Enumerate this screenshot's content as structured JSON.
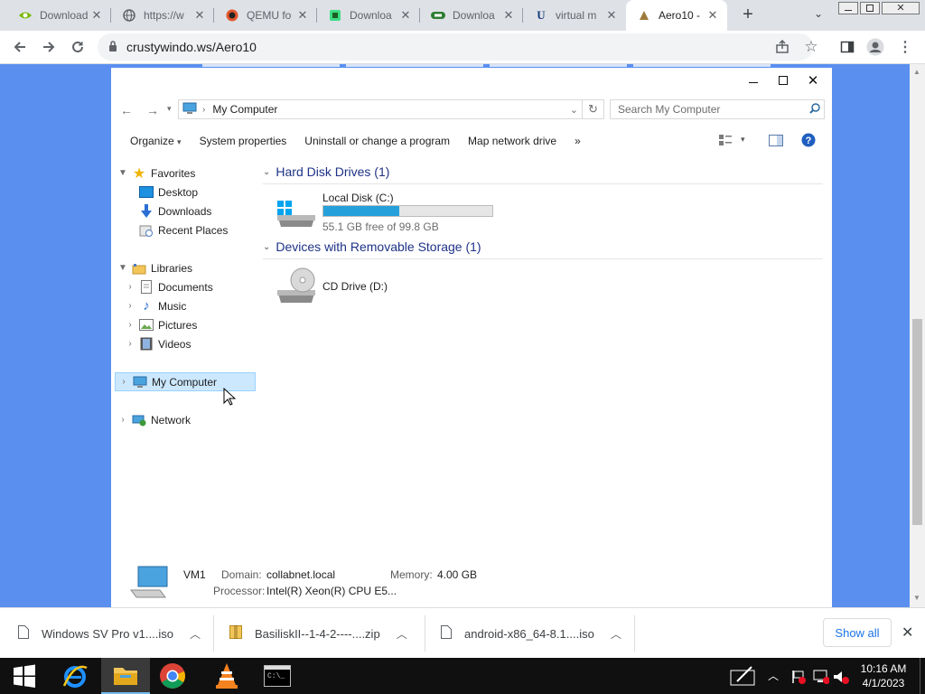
{
  "browser": {
    "tabs": [
      {
        "title": "Download",
        "icon": "nvidia-icon",
        "color": "#76b900"
      },
      {
        "title": "https://w",
        "icon": "globe-icon",
        "color": "#5f6368"
      },
      {
        "title": "QEMU fo",
        "icon": "qemu-icon",
        "color": "#e4572e"
      },
      {
        "title": "Downloa",
        "icon": "android-icon",
        "color": "#3ddc84"
      },
      {
        "title": "Downloa",
        "icon": "download-site-icon",
        "color": "#2e7d32"
      },
      {
        "title": "virtual m",
        "icon": "ul-icon",
        "color": "#1a3d7c"
      },
      {
        "title": "Aero10 -",
        "icon": "aero-icon",
        "color": "#9e7b3c"
      }
    ],
    "url": "crustywindo.ws/Aero10"
  },
  "explorer": {
    "address": "My Computer",
    "search_placeholder": "Search My Computer",
    "commands": [
      "Organize",
      "System properties",
      "Uninstall or change a program",
      "Map network drive"
    ],
    "more": "»",
    "nav": {
      "favorites": "Favorites",
      "desktop": "Desktop",
      "downloads": "Downloads",
      "recent": "Recent Places",
      "libraries": "Libraries",
      "documents": "Documents",
      "music": "Music",
      "pictures": "Pictures",
      "videos": "Videos",
      "computer": "My Computer",
      "network": "Network"
    },
    "groups": {
      "hdd": "Hard Disk Drives (1)",
      "removable": "Devices with Removable Storage (1)"
    },
    "drives": {
      "c_name": "Local Disk (C:)",
      "c_free": "55.1 GB free of 99.8 GB",
      "c_used_fraction": 0.448,
      "d_name": "CD Drive (D:)"
    },
    "details": {
      "name": "VM1",
      "domain_label": "Domain:",
      "domain": "collabnet.local",
      "memory_label": "Memory:",
      "memory": "4.00 GB",
      "processor_label": "Processor:",
      "processor": "Intel(R) Xeon(R) CPU E5..."
    }
  },
  "downloads": {
    "items": [
      "Windows SV Pro v1....iso",
      "BasiliskII--1-4-2----....zip",
      "android-x86_64-8.1....iso"
    ],
    "show_all": "Show all"
  },
  "taskbar": {
    "time": "10:16 AM",
    "date": "4/1/2023"
  }
}
